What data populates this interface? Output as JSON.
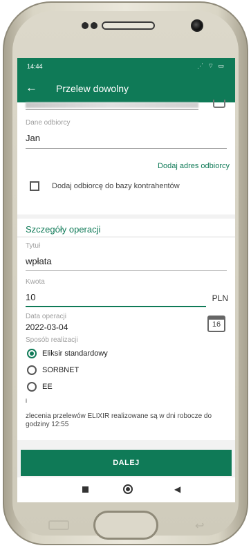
{
  "status_bar": {
    "time": "14:44",
    "icons": "⋰ ⌔ ▭"
  },
  "app_bar": {
    "back_icon": "←",
    "title": "Przelew dowolny"
  },
  "recipient": {
    "label": "Dane odbiorcy",
    "value": "Jan",
    "add_address_link": "Dodaj adres odbiorcy",
    "save_checkbox_label": "Dodaj odbiorcę do bazy kontrahentów",
    "save_checkbox_checked": false
  },
  "details": {
    "section_title": "Szczegóły operacji",
    "title_label": "Tytuł",
    "title_value": "wpłata",
    "amount_label": "Kwota",
    "amount_value": "10",
    "currency": "PLN",
    "date_label": "Data operacji",
    "date_value": "2022-03-04",
    "calendar_day": "16",
    "method_label": "Sposób realizacji",
    "methods": [
      {
        "label": "Eliksir standardowy",
        "selected": true
      },
      {
        "label": "SORBNET",
        "selected": false
      },
      {
        "label": "EE",
        "selected": false
      }
    ],
    "marker": "i",
    "info": "zlecenia przelewów ELIXIR realizowane są w dni robocze do godziny 12:55"
  },
  "actions": {
    "next_label": "DALEJ"
  },
  "nav": {
    "back_glyph": "◀"
  },
  "colors": {
    "brand_green": "#0f7a57"
  }
}
